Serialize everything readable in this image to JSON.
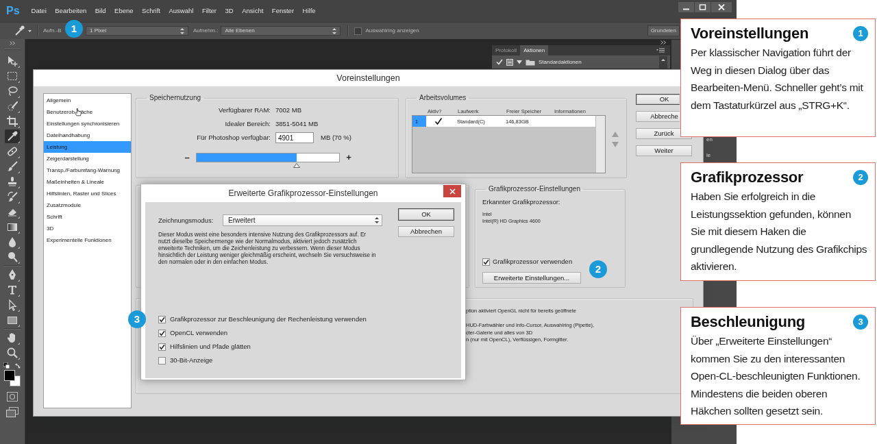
{
  "app": {
    "logo": "Ps",
    "menu": [
      "Datei",
      "Bearbeiten",
      "Bild",
      "Ebene",
      "Schrift",
      "Auswahl",
      "Filter",
      "3D",
      "Ansicht",
      "Fenster",
      "Hilfe"
    ],
    "options_bar": {
      "sample_size_label": "Aufn.-B",
      "marker": "1",
      "sample_size": "1 Pixel",
      "sample_label": "Aufnehm.:",
      "sample": "Alle Ebenen",
      "show_ring": {
        "label": "Auswahlring anzeigen",
        "checked": false
      },
      "workspace": "Grundelen"
    },
    "tools": [
      {
        "kind": "move",
        "selected": false
      },
      {
        "kind": "marquee",
        "selected": false
      },
      {
        "kind": "lasso",
        "selected": false
      },
      {
        "kind": "quick-select",
        "selected": false
      },
      {
        "kind": "crop",
        "selected": false
      },
      {
        "kind": "eyedropper",
        "selected": true
      },
      {
        "kind": "healing",
        "selected": false
      },
      {
        "kind": "brush",
        "selected": false
      },
      {
        "kind": "stamp",
        "selected": false
      },
      {
        "kind": "history-brush",
        "selected": false
      },
      {
        "kind": "eraser",
        "selected": false
      },
      {
        "kind": "gradient",
        "selected": false
      },
      {
        "kind": "blur",
        "selected": false
      },
      {
        "kind": "dodge",
        "selected": false
      },
      {
        "kind": "pen",
        "selected": false
      },
      {
        "kind": "type",
        "selected": false
      },
      {
        "kind": "path-select",
        "selected": false
      },
      {
        "kind": "shape",
        "selected": false
      },
      {
        "kind": "hand",
        "selected": false
      },
      {
        "kind": "zoom",
        "selected": false
      }
    ],
    "actions_panel": {
      "tabs": [
        {
          "label": "Protokoll",
          "selected": false
        },
        {
          "label": "Aktionen",
          "selected": true
        }
      ],
      "sets": [
        {
          "label": "Standardaktionen",
          "enabled": true,
          "expanded": true
        }
      ]
    },
    "side_panel": {
      "labels": [
        "en",
        "le"
      ]
    }
  },
  "preferences": {
    "title": "Voreinstellungen",
    "nav": [
      {
        "label": "Allgemein",
        "selected": false
      },
      {
        "label": "Benutzerob",
        "label_after_cursor": "äche",
        "selected": false
      },
      {
        "label": "Einstellungen synchronisieren",
        "selected": false
      },
      {
        "label": "Dateihandhabung",
        "selected": false
      },
      {
        "label": "Leistung",
        "selected": true
      },
      {
        "label": "Zeigerdarstellung",
        "selected": false
      },
      {
        "label": "Transp./Farbumfang-Warnung",
        "selected": false
      },
      {
        "label": "Maßeinheiten & Lineale",
        "selected": false
      },
      {
        "label": "Hilfslinien, Raster und Slices",
        "selected": false
      },
      {
        "label": "Zusatzmodule",
        "selected": false
      },
      {
        "label": "Schrift",
        "selected": false
      },
      {
        "label": "3D",
        "selected": false
      },
      {
        "label": "Experimentelle Funktionen",
        "selected": false
      }
    ],
    "memory": {
      "legend": "Speichernutzung",
      "rows": [
        {
          "label": "Verfügbarer RAM:",
          "value": "7002 MB"
        },
        {
          "label": "Idealer Bereich:",
          "value": "3851-5041 MB"
        }
      ],
      "available_label": "Für Photoshop verfügbar:",
      "available_value": "4901",
      "available_unit": "MB (70 %)",
      "slider": {
        "minus": "–",
        "plus": "+",
        "level": 0.7
      }
    },
    "scratch_disks": {
      "legend": "Arbeitsvolumes",
      "columns": [
        "Aktiv?",
        "Laufwerk",
        "Freier Speicher",
        "Informationen"
      ],
      "rows": [
        {
          "number": "1",
          "active": true,
          "drive": "Standard(C)",
          "free": "146,83GB",
          "selected": true
        }
      ]
    },
    "buttons": [
      {
        "label": "OK",
        "default": true
      },
      {
        "label": "Abbreche",
        "default": false
      },
      {
        "label": "Zurück",
        "default": false
      },
      {
        "label": "Weiter",
        "default": false
      }
    ],
    "gpu": {
      "legend": "Grafikprozessor-Einstellungen",
      "detected_label": "Erkannter Grafikprozessor:",
      "vendor": "Intel",
      "model": "Intel(R) HD Graphics 4600",
      "use_gpu": {
        "label": "Grafikprozessor verwenden",
        "checked": true
      },
      "advanced_button": "Erweiterte Einstellungen...",
      "marker": "2"
    },
    "gpu_notes": {
      "note": "ption aktiviert OpenGL nicht für bereits geöffnete",
      "features": [
        "HUD-Farbwähler und Info-Cursor, Auswahlring (Pipette),",
        "cter-Galerie und alles von 3D",
        "n (nur mit OpenCL), Verflüssigen, Formgitter."
      ]
    }
  },
  "advanced_dialog": {
    "title": "Erweiterte Grafikprozessor-Einstellungen",
    "mode_label": "Zeichnungsmodus:",
    "mode": "Erweitert",
    "description": "Dieser Modus weist eine besonders intensive Nutzung des Grafikprozessors auf. Er nutzt dieselbe Speichermenge wie der Normalmodus, aktiviert jedoch zusätzlich erweiterte Techniken, um die Zeichenleistung zu verbessern. Wenn dieser Modus hinsichtlich der Leistung weniger gleichmäßig erscheint, wechseln Sie versuchsweise in den normalen oder in den einfachen Modus.",
    "buttons": [
      {
        "label": "OK",
        "default": true
      },
      {
        "label": "Abbrechen",
        "default": false
      }
    ],
    "options": [
      {
        "label": "Grafikprozessor zur Beschleunigung der Rechenleistung verwenden",
        "checked": true
      },
      {
        "label": "OpenCL verwenden",
        "checked": true
      },
      {
        "label": "Hilfslinien und Pfade glätten",
        "checked": true
      },
      {
        "label": "30-Bit-Anzeige",
        "checked": false
      }
    ],
    "marker": "3"
  },
  "callouts": [
    {
      "number": "1",
      "title": "Voreinstellungen",
      "text": "Per klassischer Navigation führt der Weg in diesen Dialog über das Bearbeiten-Menü. Schneller geht’s mit dem Tastaturkürzel aus „STRG+K“."
    },
    {
      "number": "2",
      "title": "Grafikprozessor",
      "text": "Haben Sie erfolgreich in die Leistungssektion gefunden, können Sie mit diesem Haken die grundlegende Nutzung des Grafikchips aktivieren."
    },
    {
      "number": "3",
      "title": "Beschleunigung",
      "text": "Über „Erweiterte Einstellungen“ kommen Sie zu den interessanten Open-CL-beschleunigten Funktionen. Mindestens die beiden oberen Häkchen sollten gesetzt sein."
    }
  ]
}
